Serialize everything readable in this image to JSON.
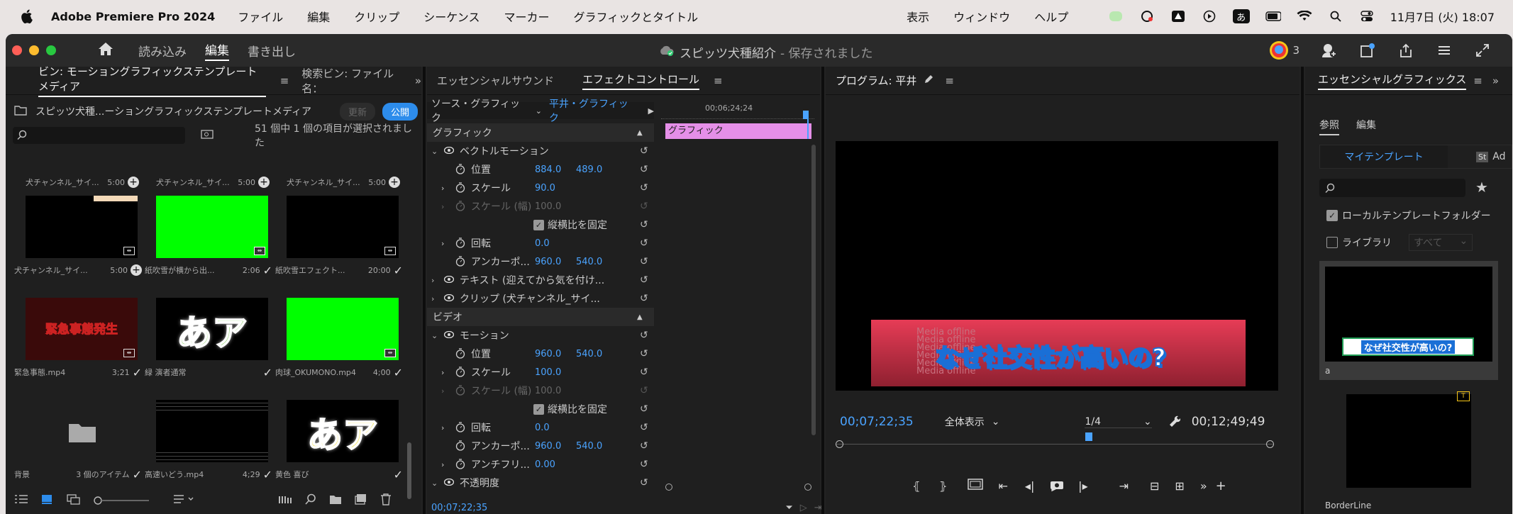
{
  "menubar": {
    "app_name": "Adobe Premiere Pro 2024",
    "menus": [
      "ファイル",
      "編集",
      "クリップ",
      "シーケンス",
      "マーカー",
      "グラフィックとタイトル",
      "表示",
      "ウィンドウ",
      "ヘルプ"
    ],
    "ime_label": "あ",
    "datetime": "11月7日 (火)  18:07"
  },
  "titlebar": {
    "tabs": [
      "読み込み",
      "編集",
      "書き出し"
    ],
    "active_tab": "編集",
    "doc_title": "スピッツ犬種紹介",
    "doc_status": " - 保存されました",
    "badge_count": "3"
  },
  "project": {
    "tab_active": "ビン: モーショングラフィックステンプレートメディア",
    "tab_other": "検索ビン: ファイル名：",
    "bin_path": "スピッツ犬種...ーショングラフィックステンプレートメディア",
    "update_label": "更新",
    "publish_label": "公開",
    "selection_status": "51 個中 1 個の項目が選択されました",
    "header_captions": [
      {
        "name": "犬チャンネル_サイ...",
        "dur": "5:00"
      },
      {
        "name": "犬チャンネル_サイ...",
        "dur": "5:00"
      },
      {
        "name": "犬チャンネル_サイ...",
        "dur": "5:00"
      }
    ],
    "items": [
      {
        "name": "犬チャンネル_サイ...",
        "dur": "5:00",
        "thumb": "black-bar"
      },
      {
        "name": "紙吹雪が横から出...",
        "dur": "2:06",
        "thumb": "green"
      },
      {
        "name": "紙吹雪エフェクト...",
        "dur": "20:00",
        "thumb": "black"
      },
      {
        "name": "緊急事態.mp4",
        "dur": "3;21",
        "thumb": "emergency",
        "thumb_text": "緊急事態発生"
      },
      {
        "name": "緑 演者通常",
        "dur": "",
        "thumb": "a-green",
        "thumb_text": "あア"
      },
      {
        "name": "肉球_OKUMONO.mp4",
        "dur": "4;00",
        "thumb": "green"
      },
      {
        "name": "背景",
        "dur": "3 個のアイテム",
        "thumb": "folder"
      },
      {
        "name": "高速いどう.mp4",
        "dur": "4;29",
        "thumb": "stripes"
      },
      {
        "name": "黄色 喜び",
        "dur": "",
        "thumb": "a-yellow",
        "thumb_text": "あア"
      }
    ]
  },
  "effects": {
    "tab_sound": "エッセンシャルサウンド",
    "tab_active": "エフェクトコントロール",
    "source_label": "ソース・グラフィック",
    "target_label": "平井・グラフィック",
    "timecode_top": "00;06;24;24",
    "clip_label": "グラフィック",
    "section_graphic": "グラフィック",
    "vector_motion": "ベクトルモーション",
    "rows_graphic": [
      {
        "label": "位置",
        "v1": "884.0",
        "v2": "489.0"
      },
      {
        "label": "スケール",
        "v1": "90.0",
        "v2": ""
      },
      {
        "label": "スケール (幅)",
        "v1": "100.0",
        "v2": "",
        "disabled": true
      },
      {
        "label": "縦横比を固定",
        "v1": "",
        "v2": "",
        "checkbox": true
      },
      {
        "label": "回転",
        "v1": "0.0",
        "v2": ""
      },
      {
        "label": "アンカーポ...",
        "v1": "960.0",
        "v2": "540.0"
      }
    ],
    "text_layer": "テキスト (迎えてから気を付け...",
    "clip_layer": "クリップ (犬チャンネル_サイ...",
    "section_video": "ビデオ",
    "motion": "モーション",
    "rows_video": [
      {
        "label": "位置",
        "v1": "960.0",
        "v2": "540.0"
      },
      {
        "label": "スケール",
        "v1": "100.0",
        "v2": ""
      },
      {
        "label": "スケール (幅)",
        "v1": "100.0",
        "v2": "",
        "disabled": true
      },
      {
        "label": "縦横比を固定",
        "v1": "",
        "v2": "",
        "checkbox": true
      },
      {
        "label": "回転",
        "v1": "0.0",
        "v2": ""
      },
      {
        "label": "アンカーポ...",
        "v1": "960.0",
        "v2": "540.0"
      },
      {
        "label": "アンチフリ...",
        "v1": "0.00",
        "v2": ""
      }
    ],
    "opacity": "不透明度",
    "timecode_bottom": "00;07;22;35"
  },
  "program": {
    "title": "プログラム: 平井",
    "overlay_text": "なぜ社交性が高いの?",
    "bg_text": "Media offline",
    "timecode_current": "00;07;22;35",
    "fit_label": "全体表示",
    "resolution": "1/4",
    "timecode_total": "00;12;49;49"
  },
  "essential": {
    "title": "エッセンシャルグラフィックス",
    "tab_browse": "参照",
    "tab_edit": "編集",
    "my_templates": "マイテンプレート",
    "adobe_stock_short": "Ad",
    "local_folder": "ローカルテンプレートフォルダー",
    "library": "ライブラリ",
    "all": "すべて",
    "template1_label": "a",
    "template1_text": "なぜ社交性が高いの?",
    "template2_label": "BorderLine"
  },
  "colors": {
    "accent_blue": "#2d8ceb",
    "green_screen": "#00ff00",
    "timeline_pink": "#e58fe8",
    "banner_red": "#d93a4e"
  }
}
